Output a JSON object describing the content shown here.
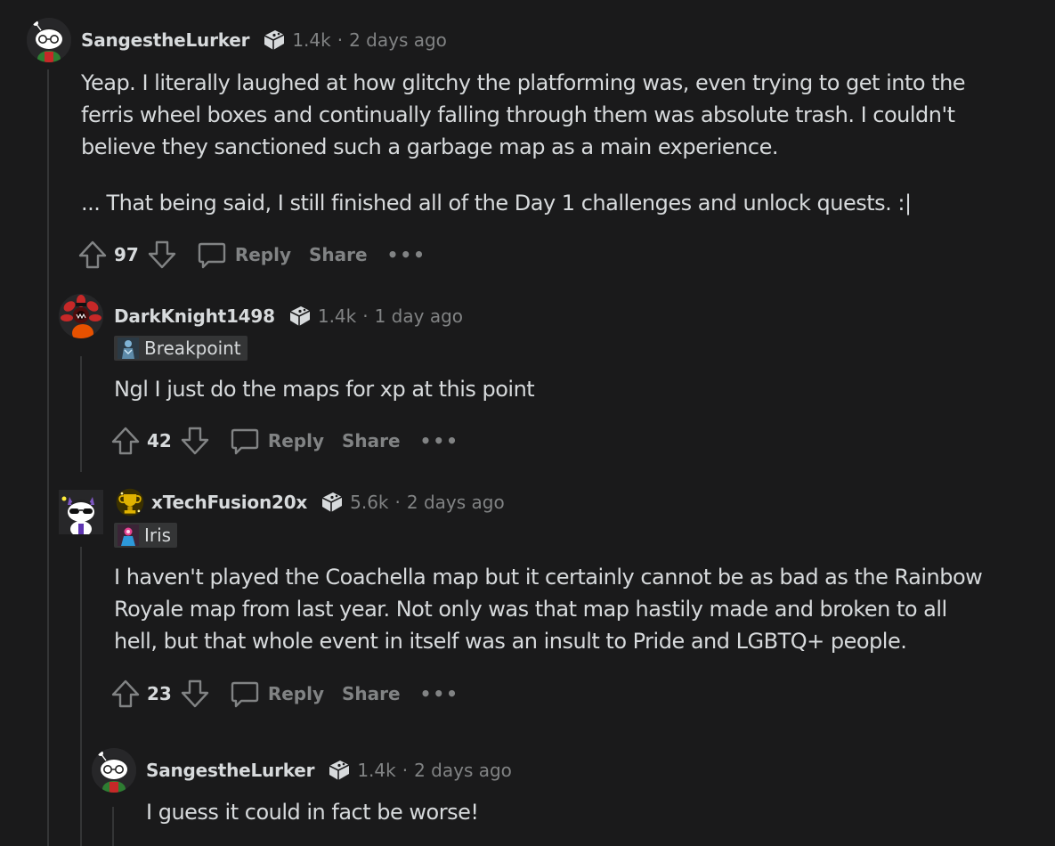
{
  "comments": [
    {
      "username": "SangestheLurker",
      "karma": "1.4k",
      "time": "2 days ago",
      "paragraphs": [
        "Yeap. I literally laughed at how glitchy the platforming was, even trying to get into the ferris wheel boxes and continually falling through them was absolute trash. I couldn't believe they sanctioned such a garbage map as a main experience.",
        "... That being said, I still finished all of the Day 1 challenges and unlock quests. :|"
      ],
      "score": "97",
      "reply_label": "Reply",
      "share_label": "Share",
      "more_label": "•••"
    },
    {
      "username": "DarkKnight1498",
      "karma": "1.4k",
      "time": "1 day ago",
      "flair": "Breakpoint",
      "paragraphs": [
        "Ngl I just do the maps for xp at this point"
      ],
      "score": "42",
      "reply_label": "Reply",
      "share_label": "Share",
      "more_label": "•••"
    },
    {
      "username": "xTechFusion20x",
      "karma": "5.6k",
      "time": "2 days ago",
      "flair": "Iris",
      "paragraphs": [
        "I haven't played the Coachella map but it certainly cannot be as bad as the Rainbow Royale map from last year. Not only was that map hastily made and broken to all hell, but that whole event in itself was an insult to Pride and LGBTQ+ people."
      ],
      "score": "23",
      "reply_label": "Reply",
      "share_label": "Share",
      "more_label": "•••"
    },
    {
      "username": "SangestheLurker",
      "karma": "1.4k",
      "time": "2 days ago",
      "paragraphs": [
        "I guess it could in fact be worse!"
      ]
    }
  ],
  "dot_separator": "·",
  "colors": {
    "background": "#1a1a1b",
    "text": "#d7dadc",
    "muted": "#818384",
    "thread_line": "#343536",
    "flair_bg": "#343536"
  }
}
